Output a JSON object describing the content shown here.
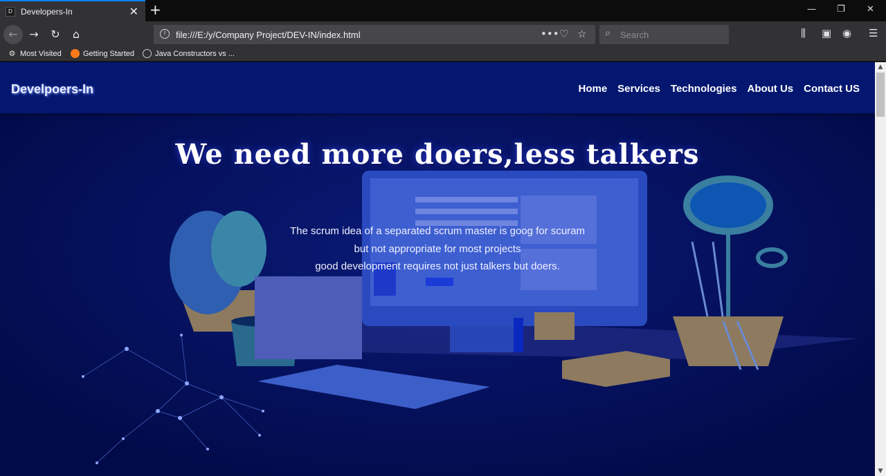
{
  "browser": {
    "tab": {
      "title": "Developers-In",
      "favicon_text": "D"
    },
    "url": "file:///E:/y/Company Project/DEV-IN/index.html",
    "search_placeholder": "Search",
    "bookmarks": [
      {
        "label": "Most Visited",
        "icon": "gear-icon"
      },
      {
        "label": "Getting Started",
        "icon": "firefox-icon"
      },
      {
        "label": "Java Constructors vs ...",
        "icon": "globe-icon"
      }
    ]
  },
  "site": {
    "brand": "Develpoers-In",
    "menu": [
      "Home",
      "Services",
      "Technologies",
      "About Us",
      "Contact US"
    ],
    "headline": "We need more doers,less talkers",
    "tagline": [
      "The scrum idea of a separated scrum master is goog for scuram",
      "but not appropriate for most projects",
      "good development requires not just talkers but doers."
    ]
  },
  "colors": {
    "header_bg": "#041770",
    "hero_bg": "#020b4a",
    "tab_accent": "#0a84ff"
  }
}
